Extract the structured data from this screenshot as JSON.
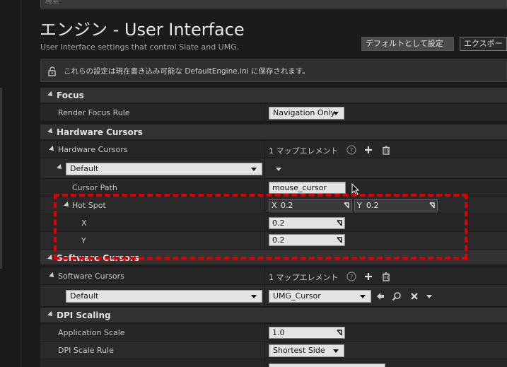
{
  "search": {
    "placeholder": "検索"
  },
  "header": {
    "title": "エンジン - User Interface",
    "subtitle": "User Interface settings that control Slate and UMG.",
    "default_button": "デフォルトとして設定",
    "export_button": "エクスポー"
  },
  "notice": {
    "text": "これらの設定は現在書き込み可能な DefaultEngine.ini に保存されます。",
    "icon": "lock-icon"
  },
  "focus": {
    "category": "Focus",
    "render_focus_rule": {
      "label": "Render Focus Rule",
      "value": "Navigation Only"
    }
  },
  "hardware_cursors": {
    "category": "Hardware Cursors",
    "map": {
      "label": "Hardware Cursors",
      "count": "1 マップエレメント"
    },
    "entry_key": "Default",
    "cursor_path": {
      "label": "Cursor Path",
      "value": "mouse_cursor"
    },
    "hot_spot": {
      "label": "Hot Spot",
      "x_axis": "X",
      "x_value": "0.2",
      "y_axis": "Y",
      "y_value": "0.2",
      "x": {
        "label": "X",
        "value": "0.2"
      },
      "y": {
        "label": "Y",
        "value": "0.2"
      }
    }
  },
  "software_cursors": {
    "category": "Software Cursors",
    "map": {
      "label": "Software Cursors",
      "count": "1 マップエレメント"
    },
    "entry_key": "Default",
    "entry_value": "UMG_Cursor"
  },
  "dpi_scaling": {
    "category": "DPI Scaling",
    "application_scale": {
      "label": "Application Scale",
      "value": "1.0"
    },
    "dpi_scale_rule": {
      "label": "DPI Scale Rule",
      "value": "Shortest Side"
    }
  },
  "colors": {
    "highlight": "#e00000",
    "category_bg": "#323232",
    "row_bg": "#262626"
  }
}
